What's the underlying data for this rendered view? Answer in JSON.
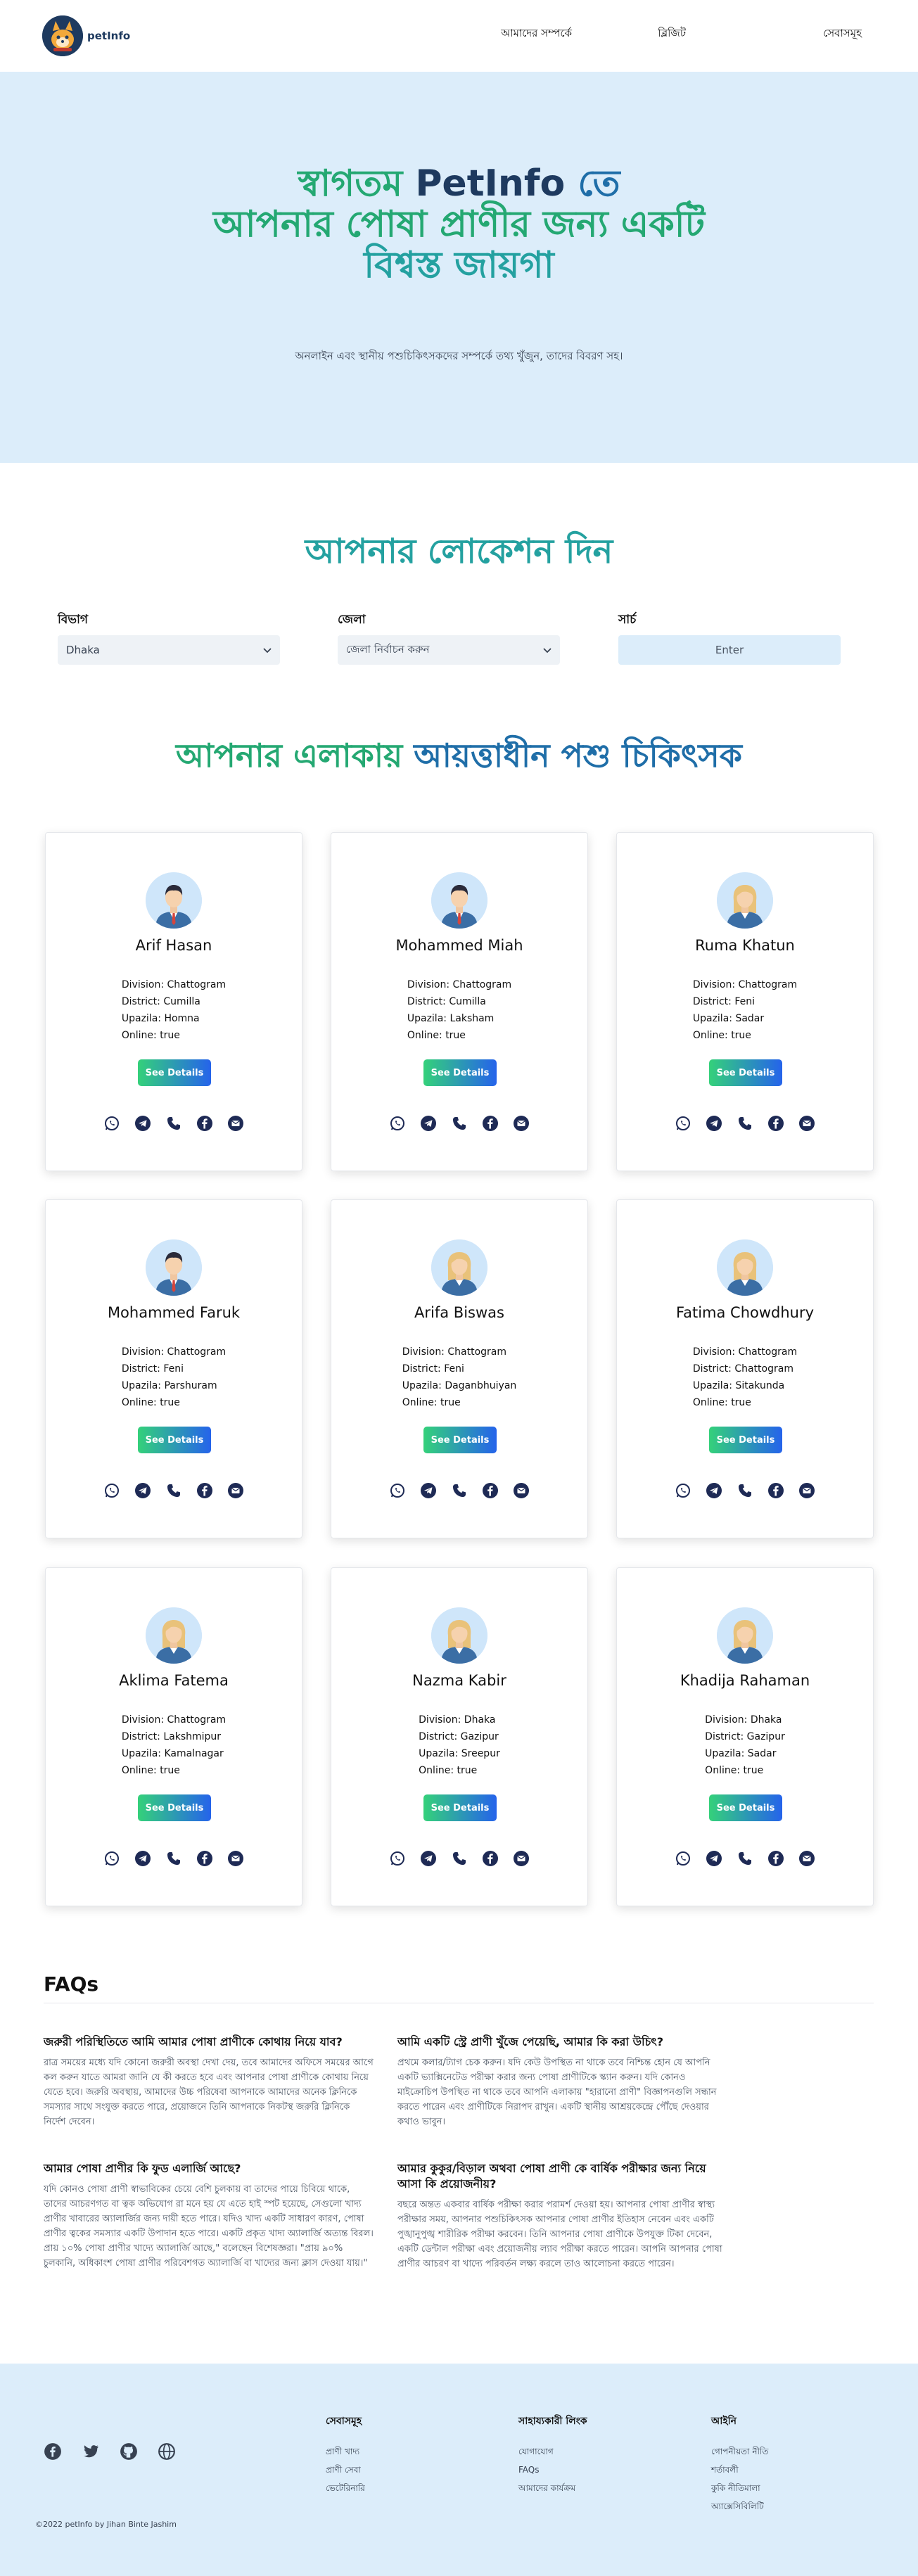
{
  "brand": {
    "name": "petInfo"
  },
  "nav": {
    "about": "আমাদের সম্পর্কে",
    "blog": "ব্লিজিট",
    "services": "সেবাসমূহ"
  },
  "hero": {
    "line1_a": "স্বাগতম",
    "line1_b": "PetInfo",
    "line1_c": "তে",
    "line2": "আপনার পোষা প্রাণীর জন্য একটি",
    "line3": "বিশ্বস্ত জায়গা",
    "subtitle": "অনলাইন এবং স্থানীয় পশুচিকিৎসকদের সম্পর্কে তথ্য খুঁজুন, তাদের বিবরণ সহ।"
  },
  "location": {
    "title": "আপনার লোকেশন দিন",
    "division_label": "বিভাগ",
    "division_value": "Dhaka",
    "district_label": "জেলা",
    "district_value": "জেলা নির্বাচন করুন",
    "search_label": "সার্চ",
    "enter_label": "Enter"
  },
  "vets_title_a": "আপনার এলাকায়",
  "vets_title_b": "আয়ত্তাধীন পশু চিকিৎসক",
  "labels": {
    "division": "Division:",
    "district": "District:",
    "upazila": "Upazila:",
    "online": "Online:",
    "details": "See Details"
  },
  "vets": [
    {
      "name": "Arif Hasan",
      "division": "Chattogram",
      "district": "Cumilla",
      "upazila": "Homna",
      "online": "true",
      "gender": "male"
    },
    {
      "name": "Mohammed Miah",
      "division": "Chattogram",
      "district": "Cumilla",
      "upazila": "Laksham",
      "online": "true",
      "gender": "male"
    },
    {
      "name": "Ruma Khatun",
      "division": "Chattogram",
      "district": "Feni",
      "upazila": "Sadar",
      "online": "true",
      "gender": "female"
    },
    {
      "name": "Mohammed Faruk",
      "division": "Chattogram",
      "district": "Feni",
      "upazila": "Parshuram",
      "online": "true",
      "gender": "male"
    },
    {
      "name": "Arifa Biswas",
      "division": "Chattogram",
      "district": "Feni",
      "upazila": "Daganbhuiyan",
      "online": "true",
      "gender": "female"
    },
    {
      "name": "Fatima Chowdhury",
      "division": "Chattogram",
      "district": "Chattogram",
      "upazila": "Sitakunda",
      "online": "true",
      "gender": "female"
    },
    {
      "name": "Aklima Fatema",
      "division": "Chattogram",
      "district": "Lakshmipur",
      "upazila": "Kamalnagar",
      "online": "true",
      "gender": "female"
    },
    {
      "name": "Nazma Kabir",
      "division": "Dhaka",
      "district": "Gazipur",
      "upazila": "Sreepur",
      "online": "true",
      "gender": "female"
    },
    {
      "name": "Khadija Rahaman",
      "division": "Dhaka",
      "district": "Gazipur",
      "upazila": "Sadar",
      "online": "true",
      "gender": "female"
    }
  ],
  "faq": {
    "title": "FAQs",
    "items": [
      {
        "q": "জরুরী পরিস্থিতিতে আমি আমার পোষা প্রাণীকে কোথায় নিয়ে যাব?",
        "a": "রাত্র সময়ের মধ্যে যদি কোনো জরুরী অবস্থা দেখা দেয়, তবে আমাদের অফিসে সময়ের আগে কল করুন যাতে আমরা জানি যে কী করতে হবে এবং আপনার পোষা প্রাণীকে কোথায় নিয়ে যেতে হবে। জরুরি অবস্থায়, আমাদের উচ্চ পরিষেবা আপনাকে আমাদের অনেক ক্লিনিকে সমস্যার সাথে সংযুক্ত করতে পারে, প্রয়োজনে তিনি আপনাকে নিকটস্থ জরুরি ক্লিনিকে নির্দেশ দেবেন।"
      },
      {
        "q": "আমি একটি স্ট্রে প্রাণী খুঁজে পেয়েছি, আমার কি করা উচিৎ?",
        "a": "প্রথমে কলার/ট্যাগ চেক করুন। যদি কেউ উপস্থিত না থাকে তবে নিশ্চিন্ত হোন যে আপনি একটি ভ্যাক্সিনেটেড পরীক্ষা করার জন্য পোষা প্রাণীটিকে স্ক্যান করুন। যদি কোনও মাইক্রোচিপ উপস্থিত না থাকে তবে আপনি এলাকায় \"হারানো প্রাণী\" বিজ্ঞাপনগুলি সন্ধান করতে পারেন এবং প্রাণীটিকে নিরাপদ রাখুন। একটি স্থানীয় আশ্রয়কেন্দ্রে পৌঁছে দেওয়ার কথাও ভাবুন।"
      },
      {
        "q": "আমার পোষা প্রাণীর কি ফুড এলার্জি আছে?",
        "a": "যদি কোনও পোষা প্রাণী স্বাভাবিকের চেয়ে বেশি চুলকায় বা তাদের পায়ে চিবিয়ে থাকে, তাদের আচরণগত বা ত্বক অভিযোগ রা মনে হয় যে এতে হাই স্পট হয়েছে, সেগুলো খাদ্য প্রাণীর খাবারের অ্যালার্জির জন্য দায়ী হতে পারে। যদিও খাদ্য একটি সাধারণ কারণ, পোষা প্রাণীর ত্বকের সমস্যার একটি উপাদান হতে পারে। একটি প্রকৃত খাদ্য অ্যালার্জি অত্যন্ত বিরল। প্রায় ১০% পোষা প্রাণীর খাদ্যে অ্যালার্জি আছে,\" বলেছেন বিশেষজ্ঞরা। \"প্রায় ৯০% চুলকানি, অধিকাংশ পোষা প্রাণীর পরিবেশগত অ্যালার্জি বা খাদ্যের জন্য ক্লাস দেওয়া যায়।\""
      },
      {
        "q": "আমার কুকুর/বিড়াল অথবা পোষা প্রাণী কে বার্ষিক পরীক্ষার জন্য নিয়ে আসা কি প্রয়োজনীয়?",
        "a": "বছরে অন্তত একবার বার্ষিক পরীক্ষা করার পরামর্শ দেওয়া হয়। আপনার পোষা প্রাণীর স্বাস্থ্য পরীক্ষার সময়, আপনার পশুচিকিৎসক আপনার পোষা প্রাণীর ইতিহাস নেবেন এবং একটি পুঙ্খানুপুঙ্খ শারীরিক পরীক্ষা করবেন। তিনি আপনার পোষা প্রাণীকে উপযুক্ত টিকা দেবেন, একটি ডেন্টাল পরীক্ষা এবং প্রয়োজনীয় ল্যাব পরীক্ষা করতে পারেন। আপনি আপনার পোষা প্রাণীর আচরণ বা খাদ্যে পরিবর্তন লক্ষ্য করলে তাও আলোচনা করতে পারেন।"
      }
    ]
  },
  "footer": {
    "col1_title": "সেবাসমূহ",
    "col1_links": [
      "প্রাণী খাদ্য",
      "প্রাণী সেবা",
      "ভেটেরিনারি"
    ],
    "col2_title": "সাহায্যকারী লিংক",
    "col2_links": [
      "যোগাযোগ",
      "FAQs",
      "আমাদের কার্যক্রম"
    ],
    "col3_title": "আইনি",
    "col3_links": [
      "গোপনীয়তা নীতি",
      "শর্তাবলী",
      "কুকি নীতিমালা",
      "অ্যাক্সেসিবিলিটি"
    ],
    "copyright": "©2022 petInfo by Jihan Binte Jashim"
  },
  "colors": {
    "green": "#24a872",
    "teal": "#24a1a0",
    "navy": "#1e3a5f",
    "blue": "#1f6ea8",
    "hero_bg": "#dcedfa",
    "social_icon": "#1e2a55"
  }
}
